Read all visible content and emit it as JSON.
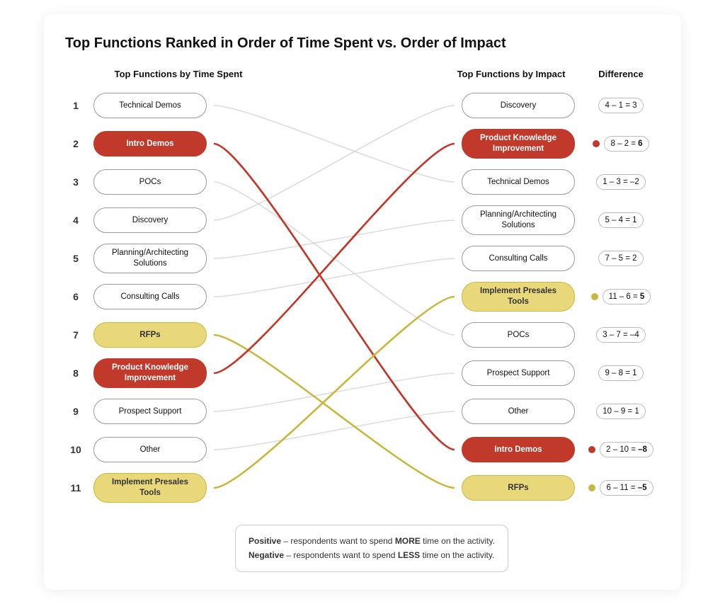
{
  "title": "Top Functions Ranked in Order of Time Spent vs. Order of Impact",
  "headers": {
    "left": "Top Functions by Time Spent",
    "right": "Top Functions by Impact",
    "diff": "Difference"
  },
  "left_items": [
    {
      "rank": 1,
      "label": "Technical Demos",
      "style": "normal"
    },
    {
      "rank": 2,
      "label": "Intro Demos",
      "style": "red"
    },
    {
      "rank": 3,
      "label": "POCs",
      "style": "normal"
    },
    {
      "rank": 4,
      "label": "Discovery",
      "style": "normal"
    },
    {
      "rank": 5,
      "label": "Planning/Architecting\nSolutions",
      "style": "normal"
    },
    {
      "rank": 6,
      "label": "Consulting Calls",
      "style": "normal"
    },
    {
      "rank": 7,
      "label": "RFPs",
      "style": "yellow"
    },
    {
      "rank": 8,
      "label": "Product Knowledge\nImprovement",
      "style": "red"
    },
    {
      "rank": 9,
      "label": "Prospect Support",
      "style": "normal"
    },
    {
      "rank": 10,
      "label": "Other",
      "style": "normal"
    },
    {
      "rank": 11,
      "label": "Implement Presales\nTools",
      "style": "yellow"
    }
  ],
  "right_items": [
    {
      "rank": 1,
      "label": "Discovery",
      "style": "normal"
    },
    {
      "rank": 2,
      "label": "Product Knowledge\nImprovement",
      "style": "red"
    },
    {
      "rank": 3,
      "label": "Technical Demos",
      "style": "normal"
    },
    {
      "rank": 4,
      "label": "Planning/Architecting\nSolutions",
      "style": "normal"
    },
    {
      "rank": 5,
      "label": "Consulting Calls",
      "style": "normal"
    },
    {
      "rank": 6,
      "label": "Implement Presales\nTools",
      "style": "yellow"
    },
    {
      "rank": 7,
      "label": "POCs",
      "style": "normal"
    },
    {
      "rank": 8,
      "label": "Prospect Support",
      "style": "normal"
    },
    {
      "rank": 9,
      "label": "Other",
      "style": "normal"
    },
    {
      "rank": 10,
      "label": "Intro Demos",
      "style": "red"
    },
    {
      "rank": 11,
      "label": "RFPs",
      "style": "yellow"
    }
  ],
  "diffs": [
    {
      "rank": 1,
      "text": "4 – 1 = 3",
      "dot": "none"
    },
    {
      "rank": 2,
      "text": "8 – 2 = ",
      "bold": "6",
      "dot": "red"
    },
    {
      "rank": 3,
      "text": "1 – 3 = –2",
      "dot": "none"
    },
    {
      "rank": 4,
      "text": "5 – 4 = 1",
      "dot": "none"
    },
    {
      "rank": 5,
      "text": "7 – 5 = 2",
      "dot": "none"
    },
    {
      "rank": 6,
      "text": "11 – 6 = ",
      "bold": "5",
      "dot": "yellow"
    },
    {
      "rank": 7,
      "text": "3 – 7 = –4",
      "dot": "none"
    },
    {
      "rank": 8,
      "text": "9 – 8 = 1",
      "dot": "none"
    },
    {
      "rank": 9,
      "text": "10 – 9 = 1",
      "dot": "none"
    },
    {
      "rank": 10,
      "text": "2 – 10 = ",
      "bold": "–8",
      "dot": "red"
    },
    {
      "rank": 11,
      "text": "6 – 11 = ",
      "bold": "–5",
      "dot": "yellow"
    }
  ],
  "legend": {
    "positive": "Positive – respondents want to spend MORE time on the activity.",
    "negative": "Negative – respondents want to spend LESS time on the activity."
  }
}
